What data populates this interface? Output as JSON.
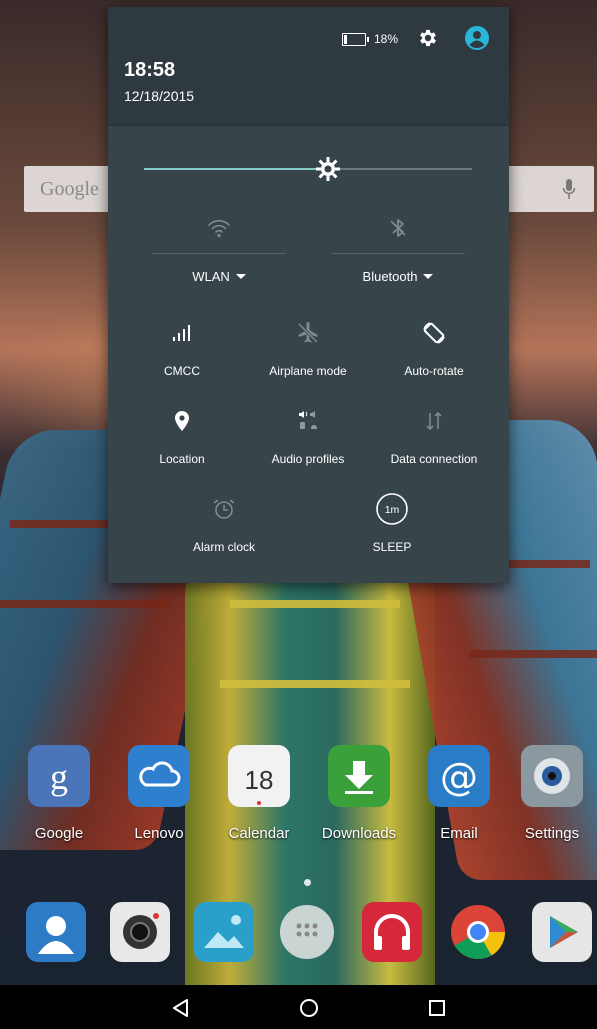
{
  "status": {
    "battery_text": "18%",
    "battery_level": 0.18,
    "time": "18:58",
    "date": "12/18/2015"
  },
  "brightness": {
    "level": 0.56
  },
  "search_bar": {
    "logo": "Google"
  },
  "quick_settings": {
    "wlan": {
      "label": "WLAN",
      "icon": "wifi-icon"
    },
    "bluetooth": {
      "label": "Bluetooth",
      "icon": "bluetooth-icon"
    },
    "tiles": [
      {
        "label": "CMCC",
        "icon": "signal-icon"
      },
      {
        "label": "Airplane mode",
        "icon": "airplane-icon"
      },
      {
        "label": "Auto-rotate",
        "icon": "auto-rotate-icon"
      },
      {
        "label": "Location",
        "icon": "location-icon"
      },
      {
        "label": "Audio profiles",
        "icon": "audio-profiles-icon"
      },
      {
        "label": "Data connection",
        "icon": "data-connection-icon"
      },
      {
        "label": "Alarm clock",
        "icon": "alarm-clock-icon"
      },
      {
        "label": "SLEEP",
        "icon": "sleep-timer-icon",
        "badge": "1m"
      }
    ]
  },
  "home_apps": [
    {
      "name": "Google",
      "icon": "google-app-icon"
    },
    {
      "name": "Lenovo",
      "icon": "lenovo-cloud-icon"
    },
    {
      "name": "Calendar",
      "icon": "calendar-icon",
      "day": "18"
    },
    {
      "name": "Downloads",
      "icon": "downloads-icon"
    },
    {
      "name": "Email",
      "icon": "email-icon"
    },
    {
      "name": "Settings",
      "icon": "settings-app-icon"
    }
  ],
  "dock": [
    "contacts-icon",
    "camera-icon",
    "gallery-icon",
    "app-drawer-icon",
    "music-icon",
    "chrome-icon",
    "play-store-icon"
  ],
  "colors": {
    "accent": "#80cbc4",
    "user_icon": "#29b6d8",
    "panel_bg": "#37444a",
    "header_bg": "#2f3a40"
  }
}
